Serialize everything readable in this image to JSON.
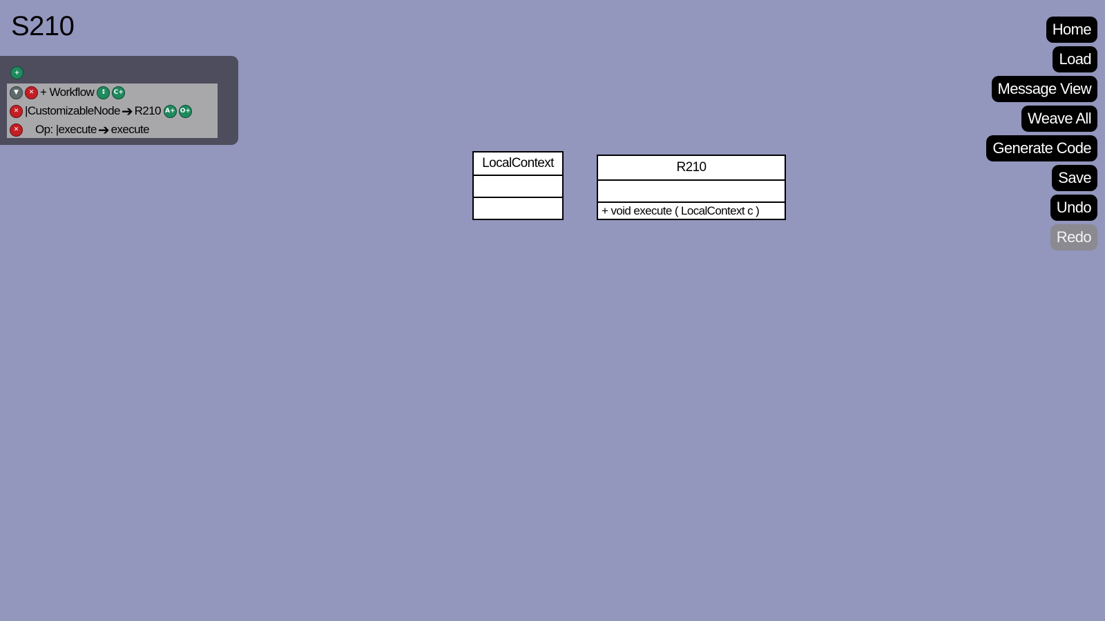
{
  "title": "S210",
  "panel": {
    "add_icon": "plus-circle-icon",
    "rows": {
      "workflow": {
        "collapse_icon": "chevron-down-icon",
        "delete_icon": "delete-icon",
        "label": "+ Workflow",
        "badge1": "↕",
        "badge2": "C+"
      },
      "node": {
        "delete_icon": "delete-icon",
        "source": "|CustomizableNode",
        "arrow": "➔",
        "target": "R210",
        "badge1": "A+",
        "badge2": "O+"
      },
      "op": {
        "delete_icon": "delete-icon",
        "source": "Op: |execute",
        "arrow": "➔",
        "target": "execute"
      }
    }
  },
  "diagram": {
    "local_context": {
      "name": "LocalContext",
      "attributes": "",
      "operations": ""
    },
    "r210": {
      "name": "R210",
      "attributes": "",
      "operations": "+ void  execute ( LocalContext  c )"
    }
  },
  "buttons": {
    "home": "Home",
    "load": "Load",
    "message_view": "Message View",
    "weave_all": "Weave All",
    "generate_code": "Generate Code",
    "save": "Save",
    "undo": "Undo",
    "redo": "Redo"
  },
  "colors": {
    "background": "#9396bd",
    "panel": "#4e4d5d",
    "tree": "#a8a8ab",
    "button": "#000000",
    "button_disabled": "#8a8a90",
    "icon_green": "#1f8a5e",
    "icon_red": "#c21f25"
  }
}
